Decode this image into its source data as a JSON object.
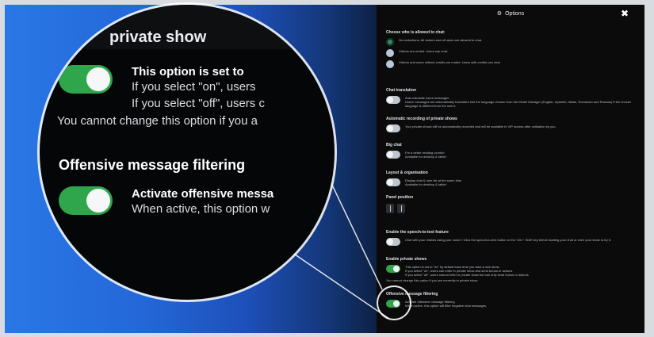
{
  "panel": {
    "title": "Options",
    "close_label": "✖",
    "sections": {
      "who": {
        "title": "Choose who is allowed to chat:",
        "options": [
          "No restrictions. All visitors and all users are allowed to chat.",
          "Visitors are muted. Users can chat.",
          "Visitors and users without credits are muted. Users with credits can chat."
        ]
      },
      "translation": {
        "title": "Chat translation",
        "label": "Auto-translate users messages",
        "desc": "Users' messages are automatically translated into the language chosen from the Model Manager (English, Spanish, Italian, Romanian and Russian) if the chosen language is different from the user's."
      },
      "recording": {
        "title": "Automatic recording of private shows",
        "desc": "Your private shows will be automatically recorded and will be available in VIP access after validation by you."
      },
      "big_chat": {
        "title": "Big chat",
        "label": "For a better reading comfort",
        "desc": "Available for desktop & tablet"
      },
      "layout": {
        "title": "Layout & organisation",
        "label": "Display chat & user list at the same time",
        "desc": "Available for desktop & tablet"
      },
      "panel_position": {
        "title": "Panel position"
      },
      "speech": {
        "title": "Enable the speech-to-text feature",
        "desc": "Chat with your visitors using your voice !! Click the speech-to-text button or the 'Ctrl + Shift' key before starting your chat or even your show to try it."
      },
      "private_shows": {
        "title": "Enable private shows",
        "desc1": "This option is set to \"on\" by default each time you start a new show.",
        "desc2": "If you select \"on\", users can enter in private show and send bonus or actions",
        "desc3": "If you select \"off\", users cannot enter in private show but can only send bonus or actions",
        "desc4": "You cannot change this option if you are currently in private show."
      },
      "offensive": {
        "title": "Offensive message filtering",
        "label": "Activate offensive message filtering",
        "desc": "When active, this option will filter negative chat messages."
      }
    }
  },
  "magnifier": {
    "title_partial": "private show",
    "line1": "This option is set to",
    "line2": "If you select \"on\", users",
    "line3": "If you select \"off\", users c",
    "line4": "You cannot change this option if you a",
    "heading": "Offensive message filtering",
    "label": "Activate offensive messa",
    "desc": "When active, this option w"
  },
  "colors": {
    "toggle_on": "#32a34a",
    "radio_selected": "#2f8b61"
  }
}
